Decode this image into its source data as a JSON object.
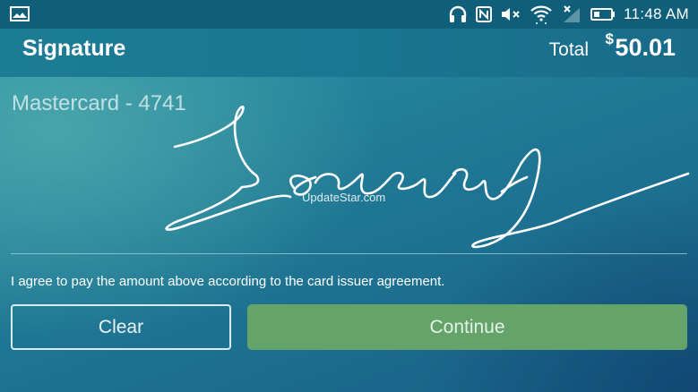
{
  "status_bar": {
    "time": "11:48",
    "time_suffix": "AM",
    "icons": [
      "gallery-icon",
      "headset-icon",
      "nfc-icon",
      "mute-icon",
      "wifi-icon",
      "no-signal-icon",
      "battery-icon"
    ]
  },
  "header": {
    "title": "Signature",
    "total_label": "Total",
    "currency_symbol": "$",
    "total_amount": "50.01"
  },
  "card": {
    "label": "Mastercard  - 4741"
  },
  "watermark": "UpdateStar.com",
  "agreement_text": "I agree to pay the amount above according to the card issuer agreement.",
  "buttons": {
    "clear": "Clear",
    "continue": "Continue"
  },
  "colors": {
    "status_bar": "#0f5f7a",
    "header": "#1c7994",
    "continue_button": "#64a46a",
    "text": "#ffffff"
  }
}
